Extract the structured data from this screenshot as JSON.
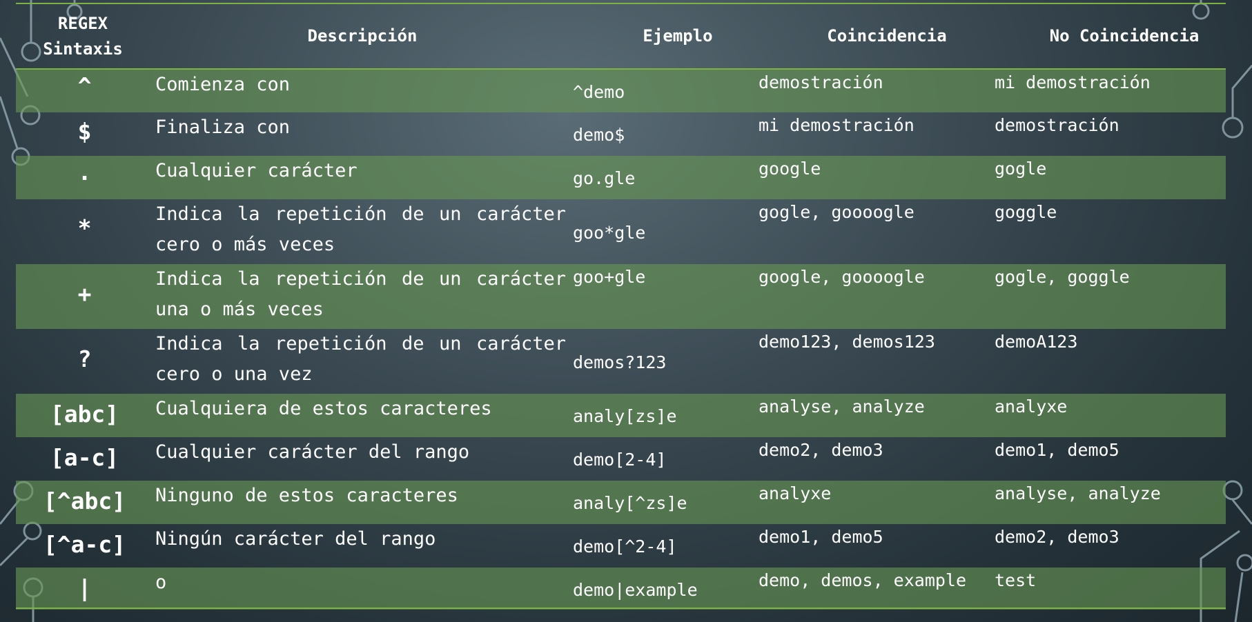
{
  "table": {
    "headers": {
      "syntax": "REGEX Sintaxis",
      "description": "Descripción",
      "example": "Ejemplo",
      "match": "Coincidencia",
      "no_match": "No Coincidencia"
    },
    "rows": [
      {
        "syntax": "^",
        "description": "Comienza con",
        "example": "^demo",
        "match": "demostración",
        "no_match": "mi demostración"
      },
      {
        "syntax": "$",
        "description": "Finaliza con",
        "example": "demo$",
        "match": "mi demostración",
        "no_match": "demostración"
      },
      {
        "syntax": ".",
        "description": "Cualquier carácter",
        "example": "go.gle",
        "match": "google",
        "no_match": "gogle"
      },
      {
        "syntax": "*",
        "description": "Indica la repetición de un carácter cero o más veces",
        "example": "goo*gle",
        "match": "gogle, goooogle",
        "no_match": "goggle"
      },
      {
        "syntax": "+",
        "description": "Indica la repetición de un carácter una o más veces",
        "example": "goo+gle",
        "match": "google, goooogle",
        "no_match": "gogle, goggle"
      },
      {
        "syntax": "?",
        "description": "Indica la repetición de un carácter cero o una vez",
        "example": "demos?123",
        "match": "demo123, demos123",
        "no_match": "demoA123"
      },
      {
        "syntax": "[abc]",
        "description": "Cualquiera de estos caracteres",
        "example": "analy[zs]e",
        "match": "analyse, analyze",
        "no_match": "analyxe"
      },
      {
        "syntax": "[a-c]",
        "description": "Cualquier carácter del rango",
        "example": "demo[2-4]",
        "match": "demo2, demo3",
        "no_match": "demo1, demo5"
      },
      {
        "syntax": "[^abc]",
        "description": "Ninguno de estos caracteres",
        "example": "analy[^zs]e",
        "match": "analyxe",
        "no_match": "analyse, analyze"
      },
      {
        "syntax": "[^a-c]",
        "description": "Ningún carácter del rango",
        "example": "demo[^2-4]",
        "match": "demo1, demo5",
        "no_match": "demo2, demo3"
      },
      {
        "syntax": "|",
        "description": "o",
        "example": "demo|example",
        "match": "demo, demos, example",
        "no_match": "test"
      }
    ]
  },
  "colors": {
    "band": "#5f8a52",
    "rule": "#7cb342",
    "background": "#2c3a42",
    "circuit": "#8fa4ad"
  }
}
